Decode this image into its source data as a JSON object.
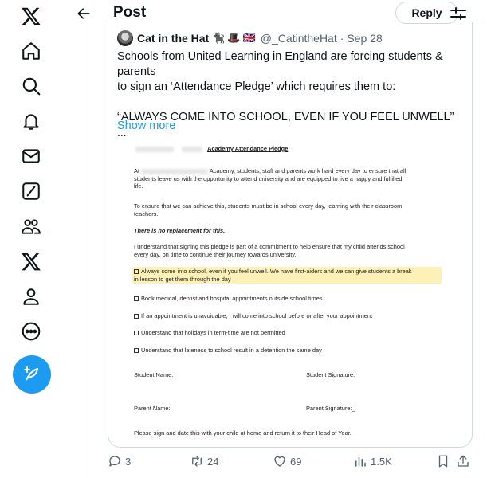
{
  "header": {
    "title": "Post",
    "reply_label": "Reply"
  },
  "quoted": {
    "name": "Cat in the Hat",
    "emojis": [
      "🐈‍⬛",
      "🎩",
      "🇬🇧"
    ],
    "handle": "@_CatintheHat",
    "separator": "·",
    "date": "Sep 28",
    "text_line1": "Schools from United Learning in England are forcing students & parents",
    "text_line2": "to sign an ‘Attendance Pledge’ which requires them to:",
    "text_line3": "“ALWAYS COME INTO SCHOOL, EVEN IF YOU FEEL UNWELL”",
    "ellipsis": "...",
    "show_more": "Show more"
  },
  "doc": {
    "title": "Academy Attendance Pledge",
    "p1_start": "At",
    "p1_rest": "Academy, students, staff and parents work hard every day to ensure that all",
    "p1_line2": "students leave us with the opportunity to attend university and are equipped to live a happy and fulfilled",
    "p1_line3": "life.",
    "p2_line1": "To ensure that we can achieve this, students must be in school every day, learning with their classroom",
    "p2_line2": "teachers.",
    "p3": "There is no replacement for this.",
    "p4_line1": "I understand that signing this pledge is part of a commitment to help ensure that my child attends school",
    "p4_line2": "every day, on time to continue their journey towards university.",
    "item1_line1": "Always come into school, even if you feel unwell. We have first-aiders and we can give students a break",
    "item1_line2": "in lesson to get them through the day",
    "item2": "Book medical, dentist and hospital appointments outside school times",
    "item3": "If an appointment is unavoidable, I will come into school before or after your appointment",
    "item4": "Understand that holidays in term-time are not permitted",
    "item5": "Understand that lateness to school result in a detention the same day",
    "student_name": "Student Name:",
    "student_signature": "Student Signature:",
    "parent_name": "Parent Name:",
    "parent_signature": "Parent Signature:_",
    "footer": "Please sign and date this with your child at home and return it to their Head of Year."
  },
  "actions": {
    "replies": "3",
    "reposts": "24",
    "likes": "69",
    "views": "1.5K"
  },
  "colors": {
    "accent": "#1d9bf0",
    "muted": "#536471",
    "highlight": "#fdf1b8"
  }
}
